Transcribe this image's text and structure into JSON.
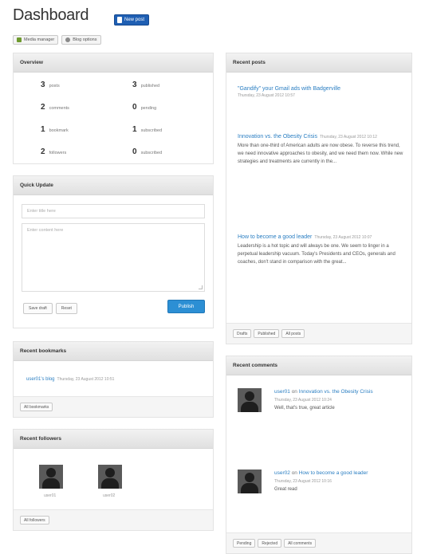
{
  "header": {
    "title": "Dashboard",
    "new_post_label": "New post"
  },
  "toolbar": {
    "media_manager": "Media manager",
    "blog_options": "Blog options"
  },
  "overview": {
    "title": "Overview",
    "stats": [
      {
        "num": "3",
        "label": "posts"
      },
      {
        "num": "3",
        "label": "published"
      },
      {
        "num": "2",
        "label": "comments"
      },
      {
        "num": "0",
        "label": "pending"
      },
      {
        "num": "1",
        "label": "bookmark"
      },
      {
        "num": "1",
        "label": "subscribed"
      },
      {
        "num": "2",
        "label": "followers"
      },
      {
        "num": "0",
        "label": "subscribed"
      }
    ]
  },
  "quick_update": {
    "title": "Quick Update",
    "title_placeholder": "Enter title here",
    "content_placeholder": "Enter content here",
    "save_draft": "Save draft",
    "reset": "Reset",
    "publish": "Publish"
  },
  "recent_bookmarks": {
    "title": "Recent bookmarks",
    "item_link": "user01's blog",
    "item_meta": "Thursday, 23 August 2012 10:51",
    "all_label": "All bookmarks"
  },
  "recent_followers": {
    "title": "Recent followers",
    "users": [
      "user01",
      "user02"
    ],
    "all_label": "All followers"
  },
  "recent_posts": {
    "title": "Recent posts",
    "items": [
      {
        "title": "\"Gandify\" your Gmail ads with Badgerville",
        "meta": "Thursday, 23 August 2012 10:57",
        "excerpt": ""
      },
      {
        "title": "Innovation vs. the Obesity Crisis",
        "meta": "Thursday, 23 August 2012 10:12",
        "excerpt": "More than one-third of American adults are now obese. To reverse this trend, we need innovative approaches to obesity, and we need them now. While new strategies and treatments are currently in the..."
      },
      {
        "title": "How to become a good leader",
        "meta": "Thursday, 23 August 2012 10:07",
        "excerpt": "Leadership is a hot topic and will always be one. We seem to linger in a perpetual leadership vacuum. Today's Presidents and CEOs, generals and coaches, don't stand in comparison with the great..."
      }
    ],
    "footer": [
      "Drafts",
      "Published",
      "All posts"
    ]
  },
  "recent_comments": {
    "title": "Recent comments",
    "items": [
      {
        "user": "user01",
        "on": "on",
        "post": "Innovation vs. the Obesity Crisis",
        "meta": "Thursday, 23 August 2012 10:24",
        "text": "Well, that's true, great article"
      },
      {
        "user": "user02",
        "on": "on",
        "post": "How to become a good leader",
        "meta": "Thursday, 23 August 2012 10:16",
        "text": "Great read"
      }
    ],
    "footer": [
      "Pending",
      "Rejected",
      "All comments"
    ]
  }
}
